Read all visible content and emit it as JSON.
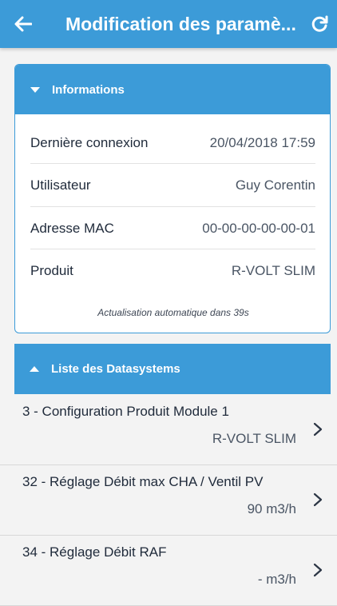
{
  "appbar": {
    "title": "Modification des paramè...",
    "back_icon": "arrow-left-icon",
    "refresh_icon": "refresh-icon",
    "color": "#3c9bd8"
  },
  "informations": {
    "header_label": "Informations",
    "rows": [
      {
        "label": "Dernière connexion",
        "value": "20/04/2018 17:59"
      },
      {
        "label": "Utilisateur",
        "value": "Guy Corentin"
      },
      {
        "label": "Adresse MAC",
        "value": "00-00-00-00-00-01"
      },
      {
        "label": "Produit",
        "value": "R-VOLT SLIM"
      }
    ],
    "auto_refresh": "Actualisation automatique dans  39s"
  },
  "datasystems": {
    "header_label": "Liste des Datasystems",
    "items": [
      {
        "name": "3 - Configuration Produit Module 1",
        "value": "R-VOLT SLIM"
      },
      {
        "name": "32 - Réglage Débit max CHA / Ventil PV",
        "value": "90 m3/h"
      },
      {
        "name": "34 - Réglage Débit RAF",
        "value": "- m3/h"
      }
    ]
  }
}
